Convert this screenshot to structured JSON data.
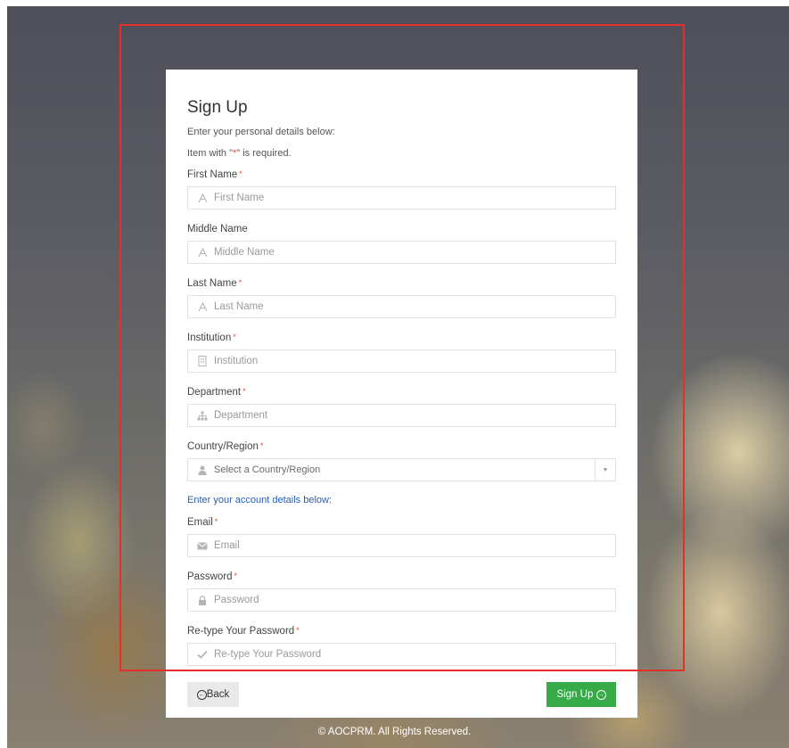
{
  "form": {
    "title": "Sign Up",
    "personal_intro": "Enter your personal details below:",
    "required_note_prefix": "Item with \"",
    "required_note_mark": "*",
    "required_note_suffix": "\" is required.",
    "account_intro": "Enter your account details below:",
    "required_color": "#e74c3c",
    "fields": {
      "first_name": {
        "label": "First Name",
        "placeholder": "First Name",
        "icon": "font-icon"
      },
      "middle_name": {
        "label": "Middle Name",
        "placeholder": "Middle Name",
        "icon": "font-icon"
      },
      "last_name": {
        "label": "Last Name",
        "placeholder": "Last Name",
        "icon": "font-icon"
      },
      "institution": {
        "label": "Institution",
        "placeholder": "Institution",
        "icon": "building-icon"
      },
      "department": {
        "label": "Department",
        "placeholder": "Department",
        "icon": "sitemap-icon"
      },
      "country": {
        "label": "Country/Region",
        "selected": "Select a Country/Region",
        "icon": "user-icon"
      },
      "email": {
        "label": "Email",
        "placeholder": "Email",
        "icon": "envelope-icon"
      },
      "password": {
        "label": "Password",
        "placeholder": "Password",
        "icon": "lock-icon"
      },
      "retype_password": {
        "label": "Re-type Your Password",
        "placeholder": "Re-type Your Password",
        "icon": "check-icon"
      }
    },
    "back_label": "Back",
    "signup_label": "Sign Up",
    "signup_color": "#35aa47"
  },
  "footer": {
    "copyright": "© AOCPRM. All Rights Reserved."
  }
}
